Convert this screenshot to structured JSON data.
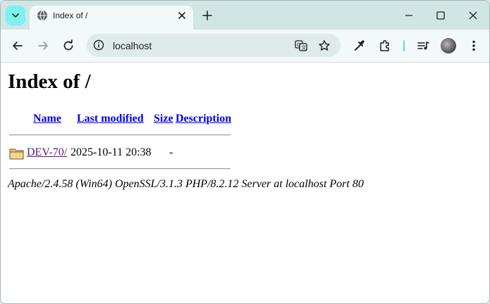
{
  "browser": {
    "tab": {
      "title": "Index of /"
    },
    "address": {
      "url": "localhost"
    }
  },
  "page": {
    "heading": "Index of /",
    "columns": {
      "name": "Name",
      "last_modified": "Last modified",
      "size": "Size",
      "description": "Description"
    },
    "rows": [
      {
        "name": "DEV-70/",
        "last_modified": "2025-10-11 20:38",
        "size": "-",
        "description": ""
      }
    ],
    "footer": "Apache/2.4.58 (Win64) OpenSSL/3.1.3 PHP/8.2.12 Server at localhost Port 80"
  },
  "icons": {
    "tab_search": "chevron-down-icon",
    "favicon": "globe-icon",
    "tab_close": "close-icon",
    "new_tab": "plus-icon",
    "minimize": "minimize-icon",
    "maximize": "maximize-icon",
    "close": "close-icon",
    "back": "arrow-left-icon",
    "forward": "arrow-right-icon",
    "reload": "reload-icon",
    "site_info": "info-icon",
    "translate": "translate-icon",
    "bookmark": "star-icon",
    "eyedropper": "eyedropper-icon",
    "extensions": "puzzle-icon",
    "media": "media-queue-icon",
    "menu": "more-vert-icon",
    "folder": "folder-icon"
  },
  "colors": {
    "tabstrip_bg": "#cfe6e4",
    "toolbar_bg": "#f3f8f8",
    "omnibox_bg": "#dfeaea",
    "link": "#0000ee",
    "visited_link": "#551a8b"
  }
}
